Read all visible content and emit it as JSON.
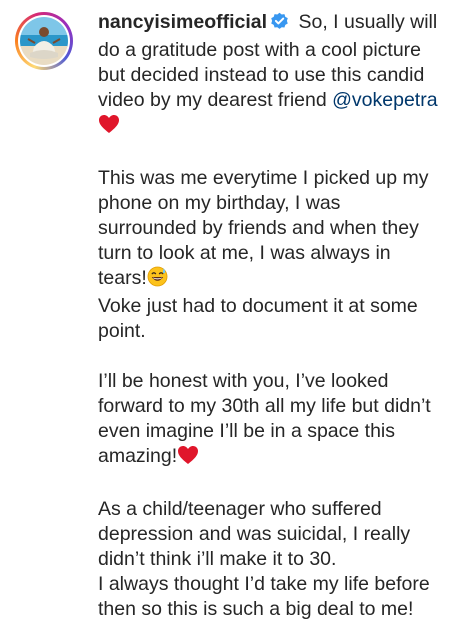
{
  "post": {
    "username": "nancyisimeofficial",
    "verified_icon": "verified-badge-icon",
    "caption_intro": " So, I usually will do a gratitude post with a cool picture but decided instead to use this candid video by my dearest friend ",
    "mention": "@vokepetra",
    "p2_before_emoji": "This was me everytime I picked up my phone on my birthday, I was surrounded by friends and when they turn to look at me, I was always in tears!",
    "p2_after_emoji": "Voke just had to document it at some point.",
    "p3": "I’ll be honest with you, I’ve looked forward to my 30th all my life but didn’t even imagine I’ll be in a space this amazing!",
    "p4": "As a child/teenager who suffered depression and was suicidal, I really didn’t think i’ll make it to 30.\nI always thought I’d take my life before then so this is such a big deal to me!"
  },
  "colors": {
    "mention": "#00376b",
    "verified": "#3897f0",
    "heart": "#e0162b"
  }
}
